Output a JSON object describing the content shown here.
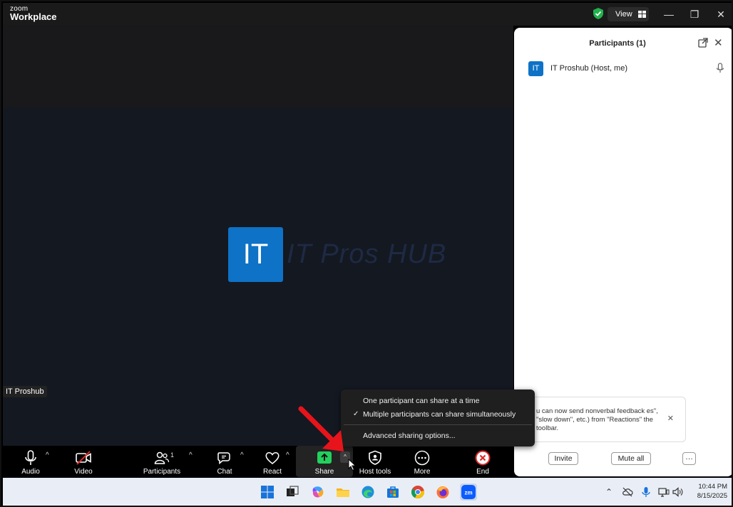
{
  "app": {
    "brand_small": "zoom",
    "brand_big": "Workplace",
    "view_label": "View"
  },
  "stage": {
    "avatar_initials": "IT",
    "watermark_text": "IT Pros HUB",
    "name_tag": "IT Proshub"
  },
  "panel": {
    "title": "Participants (1)",
    "participant": {
      "initials": "IT",
      "name": "IT Proshub (Host, me)"
    },
    "toast_text": "u can now send nonverbal feedback es\", \"slow down\", etc.) from \"Reactions\" the toolbar.",
    "invite_label": "Invite",
    "mute_all_label": "Mute all",
    "more_label": "···"
  },
  "toolbar": {
    "audio": "Audio",
    "video": "Video",
    "participants": "Participants",
    "participants_count": "1",
    "chat": "Chat",
    "react": "React",
    "share": "Share",
    "host_tools": "Host tools",
    "more": "More",
    "end": "End"
  },
  "share_menu": {
    "items": [
      "One participant can share at a time",
      "Multiple participants can share simultaneously",
      "Advanced sharing options..."
    ],
    "checked_index": 1
  },
  "taskbar": {
    "time": "10:44 PM",
    "date": "8/15/2025"
  },
  "colors": {
    "accent_blue": "#0e72c6",
    "share_green": "#23d05d",
    "end_red": "#e02828",
    "annotation_red": "#e8141b"
  }
}
